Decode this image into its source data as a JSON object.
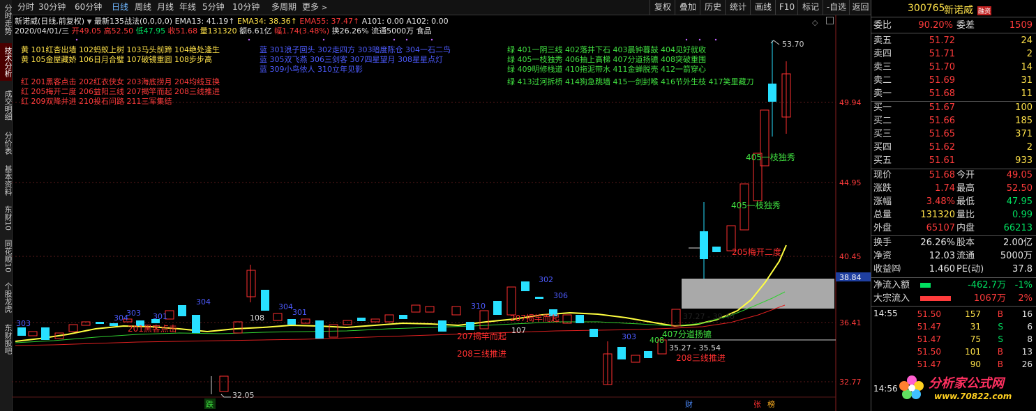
{
  "left_nav": [
    "分时走势",
    "技术分析",
    "成交明细",
    "分价表",
    "基本资料",
    "东财10",
    "同花顺10",
    "个股龙虎",
    "东财股吧"
  ],
  "toolbar": {
    "periods": [
      "分时",
      "30分钟",
      "60分钟",
      "日线",
      "周线",
      "月线",
      "年线",
      "5分钟",
      "10分钟",
      "多周期",
      "更多"
    ],
    "active_period": "日线",
    "right_buttons": [
      "复权",
      "叠加",
      "历史",
      "统计",
      "画线",
      "F10",
      "标记",
      "-自选",
      "返回"
    ]
  },
  "chart": {
    "name_line": "新诺威(日线,前复权)",
    "formula_name": "最新135战法(0,0,0,0)",
    "ema13": "EMA13: 41.19↑",
    "ema34": "EMA34: 38.36↑",
    "ema55": "EMA55: 37.47↑",
    "a101": "A101: 0.00",
    "a102": "A102: 0.00",
    "date_line": "2020/04/01/三",
    "open": "开49.05",
    "high": "高52.50",
    "low": "低47.95",
    "close": "收51.68",
    "vol": "量131320",
    "amount": "额6.61亿",
    "change": "幅1.74(3.48%)",
    "turnover": "换26.26%",
    "float": "流通5000万",
    "industry": "食品",
    "y_labels": [
      "49.94",
      "44.95",
      "40.45",
      "36.41",
      "32.77"
    ],
    "price_tag": "38.84",
    "max_label": "53.70",
    "min_label": "32.05",
    "legend_yellow": [
      "黄 101红杏出墙 102蚂蚁上树 103马头前蹄 104绝处逢生",
      "黄 105金屋藏娇 106日月合璧 107破镜重圆 108步步高"
    ],
    "legend_red": [
      "红 201黑客点击 202红衣侠女 203海底捞月 204均线互换",
      "红 205梅开二度 206益阳三线 207揭竿而起 208三线推进",
      "红 209双降并进 210投石问路 211三军集结"
    ],
    "legend_blue": [
      "蓝 301浪子回头 302走四方 303暗度陈仓 304一石二鸟",
      "蓝 305双飞燕 306三剑客 307四星望月 308星星点灯",
      "蓝 309小鸟依人 310立年见影"
    ],
    "legend_green": [
      "绿 401一阴三线 402落井下石 403晨钟暮鼓 404见好就收",
      "绿 405一枝独秀 406抽上高梯 407分道扬镳 408突破重围",
      "绿 409明修栈道 410拖泥带水 411金蝉脱壳 412一箭穿心",
      "绿 413过河拆桥 414狗急跳墙 415一剑封喉 416节外生枝 417笑里藏刀"
    ],
    "annotations": {
      "a405a": "405一枝独秀",
      "a405b": "405一枝独秀",
      "a205": "205梅开二度",
      "a407": "407分道扬镳",
      "a208a": "208三线推进",
      "a208b": "208三线推进",
      "a207a": "207揭竿而起",
      "a207b": "207揭竿而起",
      "a201": "201黑客点击",
      "range1": "37.27 - 39.40",
      "range2": "35.27 - 35.54",
      "n108": "108",
      "n107": "107",
      "n408": "408",
      "b303a": "303",
      "b304a": "304",
      "b303b": "303",
      "b304b": "304",
      "b301": "301",
      "b310": "310",
      "b304c": "304",
      "b306": "306",
      "b303c": "303",
      "b301b": "301",
      "b302": "302"
    },
    "bottom_tags": [
      "跌",
      "财",
      "张",
      "榜"
    ]
  },
  "quote": {
    "code": "300765",
    "name": "新诺威",
    "badge": "融资",
    "webi_label": "委比",
    "webi": "90.20%",
    "weicha_label": "委差",
    "weicha": "1509",
    "asks": [
      {
        "label": "卖五",
        "price": "51.72",
        "vol": "24"
      },
      {
        "label": "卖四",
        "price": "51.71",
        "vol": "2"
      },
      {
        "label": "卖三",
        "price": "51.70",
        "vol": "14"
      },
      {
        "label": "卖二",
        "price": "51.69",
        "vol": "31"
      },
      {
        "label": "卖一",
        "price": "51.68",
        "vol": "11"
      }
    ],
    "bids": [
      {
        "label": "买一",
        "price": "51.67",
        "vol": "100"
      },
      {
        "label": "买二",
        "price": "51.66",
        "vol": "185"
      },
      {
        "label": "买三",
        "price": "51.65",
        "vol": "371"
      },
      {
        "label": "买四",
        "price": "51.62",
        "vol": "2"
      },
      {
        "label": "买五",
        "price": "51.61",
        "vol": "933"
      }
    ],
    "stats": [
      {
        "l1": "现价",
        "v1": "51.68",
        "c1": "red",
        "l2": "今开",
        "v2": "49.05",
        "c2": "red"
      },
      {
        "l1": "涨跌",
        "v1": "1.74",
        "c1": "red",
        "l2": "最高",
        "v2": "52.50",
        "c2": "red"
      },
      {
        "l1": "涨幅",
        "v1": "3.48%",
        "c1": "red",
        "l2": "最低",
        "v2": "47.95",
        "c2": "grn"
      },
      {
        "l1": "总量",
        "v1": "131320",
        "c1": "yel",
        "l2": "量比",
        "v2": "0.99",
        "c2": "grn"
      },
      {
        "l1": "外盘",
        "v1": "65107",
        "c1": "red",
        "l2": "内盘",
        "v2": "66213",
        "c2": "grn"
      }
    ],
    "stats2": [
      {
        "l1": "换手",
        "v1": "26.26%",
        "l2": "股本",
        "v2": "2.00亿"
      },
      {
        "l1": "净资",
        "v1": "12.03",
        "l2": "流通",
        "v2": "5000万"
      },
      {
        "l1": "收益㈣",
        "v1": "1.460",
        "l2": "PE(动)",
        "v2": "37.8"
      }
    ],
    "flows": [
      {
        "label": "净流入额",
        "value": "-462.7万",
        "pct": "-1%",
        "color": "#00e060",
        "fill": 0.28
      },
      {
        "label": "大宗流入",
        "value": "1067万",
        "pct": "2%",
        "color": "#ff3b3b",
        "fill": 0.85
      }
    ],
    "ticks_time": "14:55",
    "ticks": [
      {
        "price": "51.50",
        "vol": "157",
        "side": "B",
        "n": "16"
      },
      {
        "price": "51.47",
        "vol": "31",
        "side": "S",
        "n": "6"
      },
      {
        "price": "51.47",
        "vol": "75",
        "side": "S",
        "n": "8"
      },
      {
        "price": "51.50",
        "vol": "101",
        "side": "B",
        "n": "13"
      },
      {
        "price": "51.47",
        "vol": "90",
        "side": "B",
        "n": "26"
      }
    ],
    "ticks_time2": "14:56",
    "watermark_line1": "分析家公式网",
    "watermark_line2": "www.70822.com"
  }
}
